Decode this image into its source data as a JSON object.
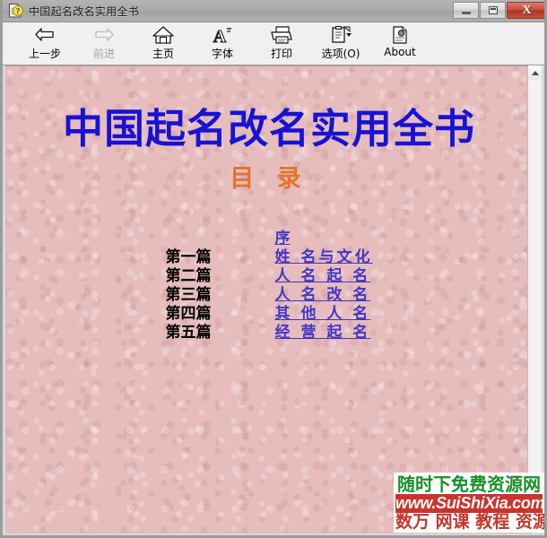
{
  "window": {
    "title": "中国起名改名实用全书",
    "icon": "help-document-icon",
    "controls": {
      "minimize": "minimize-button",
      "maximize": "maximize-button",
      "close_label": "X"
    }
  },
  "toolbar": {
    "items": [
      {
        "label": "上一步",
        "icon": "back-arrow-icon",
        "disabled": false
      },
      {
        "label": "前进",
        "icon": "forward-arrow-icon",
        "disabled": true
      },
      {
        "label": "主页",
        "icon": "home-icon",
        "disabled": false
      },
      {
        "label": "字体",
        "icon": "font-icon",
        "disabled": false
      },
      {
        "label": "打印",
        "icon": "print-icon",
        "disabled": false
      },
      {
        "label": "选项(O)",
        "icon": "options-clipboard-icon",
        "disabled": false
      },
      {
        "label": "About",
        "icon": "about-page-icon",
        "disabled": false
      }
    ]
  },
  "document": {
    "main_title": "中国起名改名实用全书",
    "sub_title": "目 录",
    "title_color": "#1812d4",
    "sub_title_color": "#e2742f",
    "link_color": "#4436c6",
    "background_color": "#e6bcbc",
    "toc": [
      {
        "label": "",
        "link": "序"
      },
      {
        "label": "第一篇",
        "link": "姓 名与文化"
      },
      {
        "label": "第二篇",
        "link": "人 名 起 名"
      },
      {
        "label": "第三篇",
        "link": "人 名 改 名"
      },
      {
        "label": "第四篇",
        "link": "其 他 人 名"
      },
      {
        "label": "第五篇",
        "link": "经 营 起 名"
      }
    ]
  },
  "scrollbar": {
    "up_icon": "scroll-up-arrow-icon",
    "down_icon": "scroll-down-arrow-icon"
  },
  "watermark": {
    "line1": "随时下免费资源网",
    "line2": "www.SuiShiXia.com",
    "line3": "数万 网课 教程 资源",
    "line1_color": "#1a8f2a",
    "line3_color": "#c9342b"
  }
}
